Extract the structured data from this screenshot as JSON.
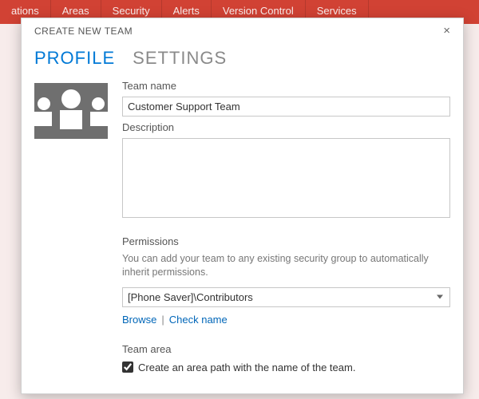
{
  "background": {
    "tabs": [
      "ations",
      "Areas",
      "Security",
      "Alerts",
      "Version Control",
      "Services"
    ]
  },
  "dialog": {
    "title": "CREATE NEW TEAM",
    "close_glyph": "×",
    "tabs": {
      "profile": "PROFILE",
      "settings": "SETTINGS"
    },
    "form": {
      "team_name_label": "Team name",
      "team_name_value": "Customer Support Team",
      "description_label": "Description",
      "description_value": "",
      "permissions_label": "Permissions",
      "permissions_help": "You can add your team to any existing security group to automatically inherit permissions.",
      "permissions_value": "[Phone Saver]\\Contributors",
      "browse_link": "Browse",
      "check_name_link": "Check name",
      "team_area_label": "Team area",
      "team_area_checkbox_label": "Create an area path with the name of the team.",
      "team_area_checked": true
    }
  }
}
